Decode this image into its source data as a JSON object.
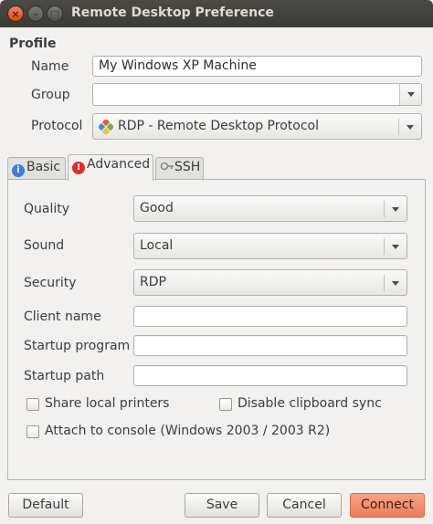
{
  "window": {
    "title": "Remote Desktop Preference",
    "close_glyph": "×",
    "min_glyph": "–",
    "max_glyph": "□"
  },
  "profile": {
    "section_title": "Profile",
    "name_label": "Name",
    "name_value": "My Windows XP Machine",
    "group_label": "Group",
    "group_value": "",
    "protocol_label": "Protocol",
    "protocol_value": "RDP - Remote Desktop Protocol"
  },
  "tabs": [
    {
      "label": "Basic",
      "icon": "info-icon",
      "active": false
    },
    {
      "label": "Advanced",
      "icon": "warning-icon",
      "active": true
    },
    {
      "label": "SSH",
      "icon": "key-icon",
      "active": false
    }
  ],
  "advanced": {
    "quality_label": "Quality",
    "quality_value": "Good",
    "sound_label": "Sound",
    "sound_value": "Local",
    "security_label": "Security",
    "security_value": "RDP",
    "client_name_label": "Client name",
    "client_name_value": "",
    "startup_program_label": "Startup program",
    "startup_program_value": "",
    "startup_path_label": "Startup path",
    "startup_path_value": "",
    "share_printers_label": "Share local printers",
    "share_printers_checked": false,
    "disable_clipboard_label": "Disable clipboard sync",
    "disable_clipboard_checked": false,
    "attach_console_label": "Attach to console (Windows 2003 / 2003 R2)",
    "attach_console_checked": false
  },
  "buttons": {
    "default_label": "Default",
    "save_label": "Save",
    "cancel_label": "Cancel",
    "connect_label": "Connect"
  },
  "colors": {
    "titlebar": "#3c3b37",
    "close_button": "#dd4814",
    "primary_button": "#ec7c58",
    "window_bg": "#f2f1f0"
  }
}
